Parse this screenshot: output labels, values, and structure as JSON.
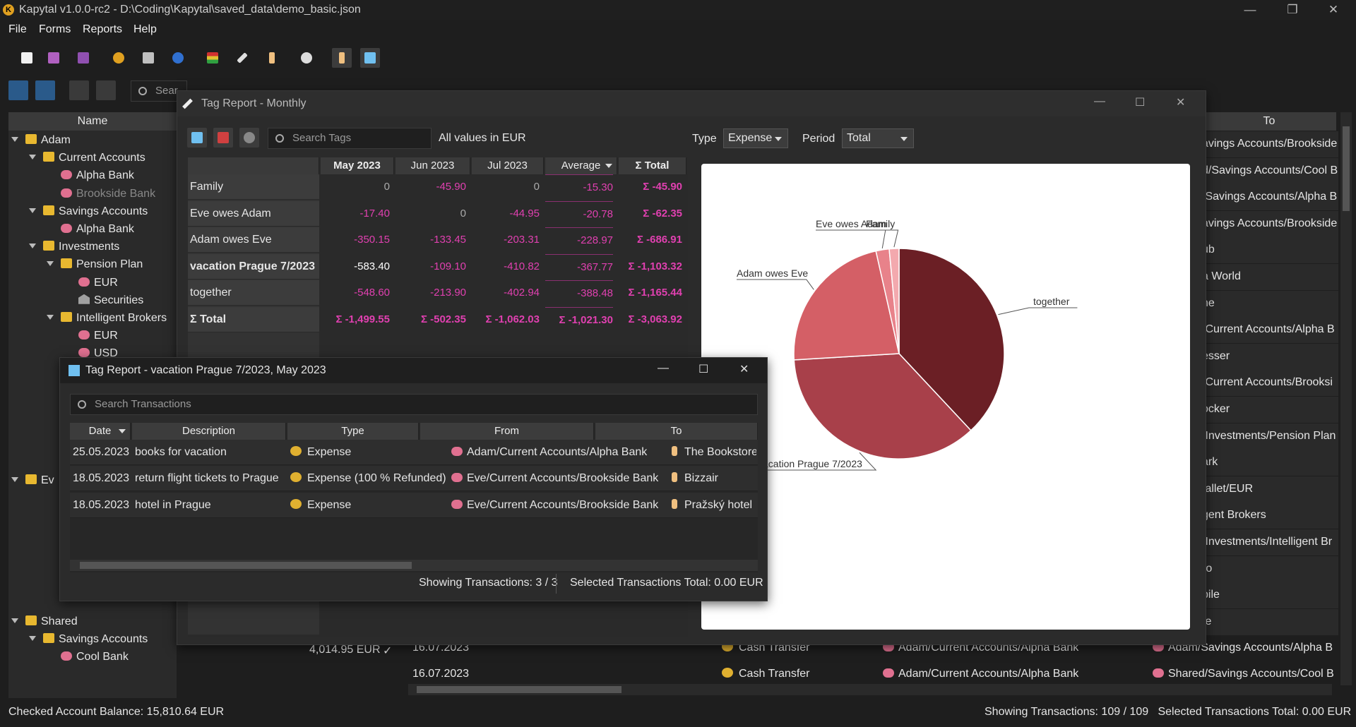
{
  "app": {
    "title": "Kapytal v1.0.0-rc2 - D:\\Coding\\Kapytal\\saved_data\\demo_basic.json"
  },
  "menu": [
    "File",
    "Forms",
    "Reports",
    "Help"
  ],
  "main": {
    "search_placeholder": "Sear",
    "tree_header": "Name",
    "right_header": "To",
    "tree": [
      {
        "label": "Adam",
        "icon": "folder",
        "level": 0,
        "expanded": true
      },
      {
        "label": "Current Accounts",
        "icon": "folder",
        "level": 1,
        "expanded": true
      },
      {
        "label": "Alpha Bank",
        "icon": "piggy",
        "level": 2
      },
      {
        "label": "Brookside Bank",
        "icon": "piggy",
        "level": 2,
        "dim": true
      },
      {
        "label": "Savings Accounts",
        "icon": "folder",
        "level": 1,
        "expanded": true
      },
      {
        "label": "Alpha Bank",
        "icon": "piggy",
        "level": 2
      },
      {
        "label": "Investments",
        "icon": "folder",
        "level": 1,
        "expanded": true
      },
      {
        "label": "Pension Plan",
        "icon": "folder",
        "level": 2,
        "expanded": true
      },
      {
        "label": "EUR",
        "icon": "piggy",
        "level": 3
      },
      {
        "label": "Securities",
        "icon": "bank",
        "level": 3
      },
      {
        "label": "Intelligent Brokers",
        "icon": "folder",
        "level": 2,
        "expanded": true
      },
      {
        "label": "EUR",
        "icon": "piggy",
        "level": 3
      },
      {
        "label": "USD",
        "icon": "piggy",
        "level": 3
      }
    ],
    "tree_bottom": [
      {
        "label": "Ev",
        "icon": "folder",
        "level": 0,
        "expanded": true
      },
      {
        "label": "Shared",
        "icon": "folder",
        "level": 0,
        "expanded": true
      },
      {
        "label": "Savings Accounts",
        "icon": "folder",
        "level": 1,
        "expanded": true
      },
      {
        "label": "Cool Bank",
        "icon": "piggy",
        "level": 2
      }
    ],
    "cool_bank_balance": "4,014.95 EUR",
    "right_col": [
      "avings Accounts/Brookside",
      "d/Savings Accounts/Cool B",
      "/Savings Accounts/Alpha B",
      "avings Accounts/Brookside",
      "ub",
      "a World",
      "ne",
      "/Current Accounts/Alpha B",
      "esser",
      "/Current Accounts/Brooksi",
      "ocker",
      "/Investments/Pension Plan",
      "ark",
      "/allet/EUR",
      "gent Brokers",
      "/Investments/Intelligent Br",
      "ro",
      "bile",
      "fe"
    ],
    "bottom_rows": [
      {
        "date": "16.07.2023",
        "type": "Cash Transfer",
        "from": "Adam/Current Accounts/Alpha Bank",
        "to": "Adam/Savings Accounts/Alpha B"
      },
      {
        "date": "16.07.2023",
        "type": "Cash Transfer",
        "from": "Adam/Current Accounts/Alpha Bank",
        "to": "Shared/Savings Accounts/Cool B"
      }
    ],
    "status_left": "Checked Account Balance: 15,810.64 EUR",
    "status_right": "Showing Transactions: 109 / 109   Selected Transactions Total: 0.00 EUR"
  },
  "tag_report": {
    "title": "Tag Report - Monthly",
    "search_placeholder": "Search Tags",
    "values_note": "All values in EUR",
    "type_label": "Type",
    "type_value": "Expense",
    "period_label": "Period",
    "period_value": "Total",
    "columns": [
      "May 2023",
      "Jun 2023",
      "Jul 2023",
      "Average",
      "Σ Total"
    ],
    "rows": [
      {
        "label": "Family",
        "values": [
          "0",
          "-45.90",
          "0",
          "-15.30",
          "Σ -45.90"
        ]
      },
      {
        "label": "Eve owes Adam",
        "values": [
          "-17.40",
          "0",
          "-44.95",
          "-20.78",
          "Σ -62.35"
        ]
      },
      {
        "label": "Adam owes Eve",
        "values": [
          "-350.15",
          "-133.45",
          "-203.31",
          "-228.97",
          "Σ -686.91"
        ]
      },
      {
        "label": "vacation Prague 7/2023",
        "values": [
          "-583.40",
          "-109.10",
          "-410.82",
          "-367.77",
          "Σ -1,103.32"
        ],
        "bold": true
      },
      {
        "label": "together",
        "values": [
          "-548.60",
          "-213.90",
          "-402.94",
          "-388.48",
          "Σ -1,165.44"
        ]
      },
      {
        "label": "Σ Total",
        "values": [
          "Σ -1,499.55",
          "Σ -502.35",
          "Σ -1,062.03",
          "Σ -1,021.30",
          "Σ -3,063.92"
        ],
        "bold": true
      }
    ]
  },
  "chart_data": {
    "type": "pie",
    "title": "",
    "categories": [
      "together",
      "vacation Prague 7/2023",
      "Adam owes Eve",
      "Eve owes Adam",
      "Family"
    ],
    "values": [
      1165.44,
      1103.32,
      686.91,
      62.35,
      45.9
    ],
    "colors": [
      "#6b1f25",
      "#a8404a",
      "#d45f66",
      "#e8828a",
      "#f3a9ae"
    ]
  },
  "detail": {
    "title": "Tag Report - vacation Prague 7/2023, May 2023",
    "search_placeholder": "Search Transactions",
    "columns": [
      "Date",
      "Description",
      "Type",
      "From",
      "To"
    ],
    "rows": [
      {
        "date": "25.05.2023",
        "description": "books for vacation",
        "type": "Expense",
        "from": "Adam/Current Accounts/Alpha Bank",
        "to": "The Bookstore"
      },
      {
        "date": "18.05.2023",
        "description": "return flight tickets to Prague",
        "type": "Expense (100 % Refunded)",
        "from": "Eve/Current Accounts/Brookside Bank",
        "to": "Bizzair"
      },
      {
        "date": "18.05.2023",
        "description": "hotel in Prague",
        "type": "Expense",
        "from": "Eve/Current Accounts/Brookside Bank",
        "to": "Pražský hotel"
      }
    ],
    "status_count": "Showing Transactions: 3 / 3",
    "status_total": "Selected Transactions Total: 0.00 EUR"
  }
}
